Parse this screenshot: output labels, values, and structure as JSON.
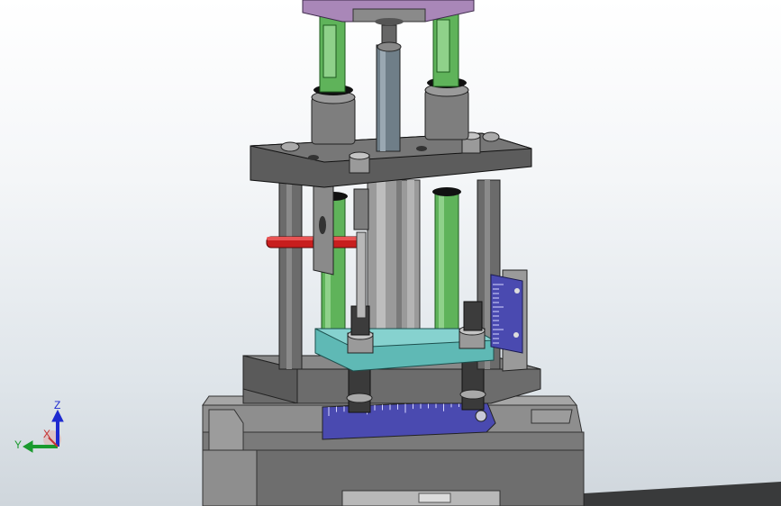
{
  "viewport": {
    "background_top": "#ffffff",
    "background_bottom": "#cfd6dc",
    "colors": {
      "guide_rod_green": "#5fb35a",
      "plate_gray": "#7c7c7c",
      "plate_gray_dark": "#4f4f4f",
      "cylinder_gray": "#9a9a9a",
      "top_plate_purple": "#a987b8",
      "teal_plate": "#5fb9b5",
      "red_pin": "#c81e1e",
      "scale_navy": "#4a4ab0",
      "base_gray": "#8a8a8a"
    }
  },
  "triad": {
    "x_label": "X",
    "y_label": "Y",
    "z_label": "Z",
    "x_color": "#c43232",
    "y_color": "#1a9a2e",
    "z_color": "#1e2ad0"
  }
}
